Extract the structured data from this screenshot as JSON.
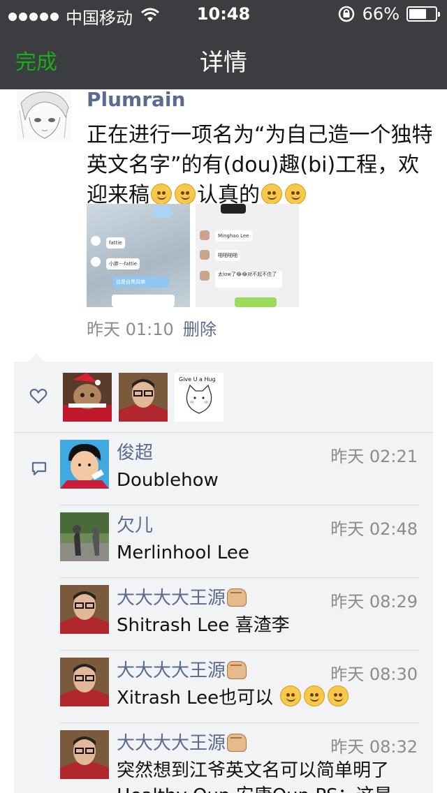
{
  "status_bar": {
    "carrier": "中国移动",
    "time": "10:48",
    "battery_percent": "66%",
    "battery_level": 0.66
  },
  "nav": {
    "done": "完成",
    "title": "详情"
  },
  "post": {
    "username": "Plumrain",
    "text_part1": "正在进行一项名为“为自己造一个独特英文名字”的有(dou)趣(bi)工程，欢迎来稿",
    "text_part2": "认真的",
    "time": "昨天 01:10",
    "delete": "删除",
    "thumb1_bubbles": [
      "fattie",
      "小胖---fattie",
      "这是自黑风嘛"
    ],
    "thumb2_bubbles": [
      "Minghao Lee",
      "啪啪啪啪",
      "太low了😂😂对不起不住了"
    ]
  },
  "colors": {
    "nav_bg": "#3b3d40",
    "accent_green": "#1aad19",
    "link_blue": "#5a6a91",
    "panel_bg": "#f2f3f5"
  },
  "comments": [
    {
      "name": "俊超",
      "time": "昨天 02:21",
      "text": "Doublehow"
    },
    {
      "name": "欠儿",
      "time": "昨天 02:48",
      "text": "Merlinhool Lee"
    },
    {
      "name": "大大大大王源",
      "time": "昨天 08:29",
      "text": "Shitrash Lee 喜渣李"
    },
    {
      "name": "大大大大王源",
      "time": "昨天 08:30",
      "text": "Xitrash Lee也可以"
    },
    {
      "name": "大大大大王源",
      "time": "昨天 08:32",
      "text": "突然想到江爷英文名可以简单明了",
      "text2": "Healthy Qun  安康Qun PS：这是"
    }
  ],
  "like_avatars": [
    "cat-santa-avatar",
    "man-glasses-avatar",
    "cat-hug-avatar"
  ],
  "like_sticker_text": "Give U a Hug"
}
